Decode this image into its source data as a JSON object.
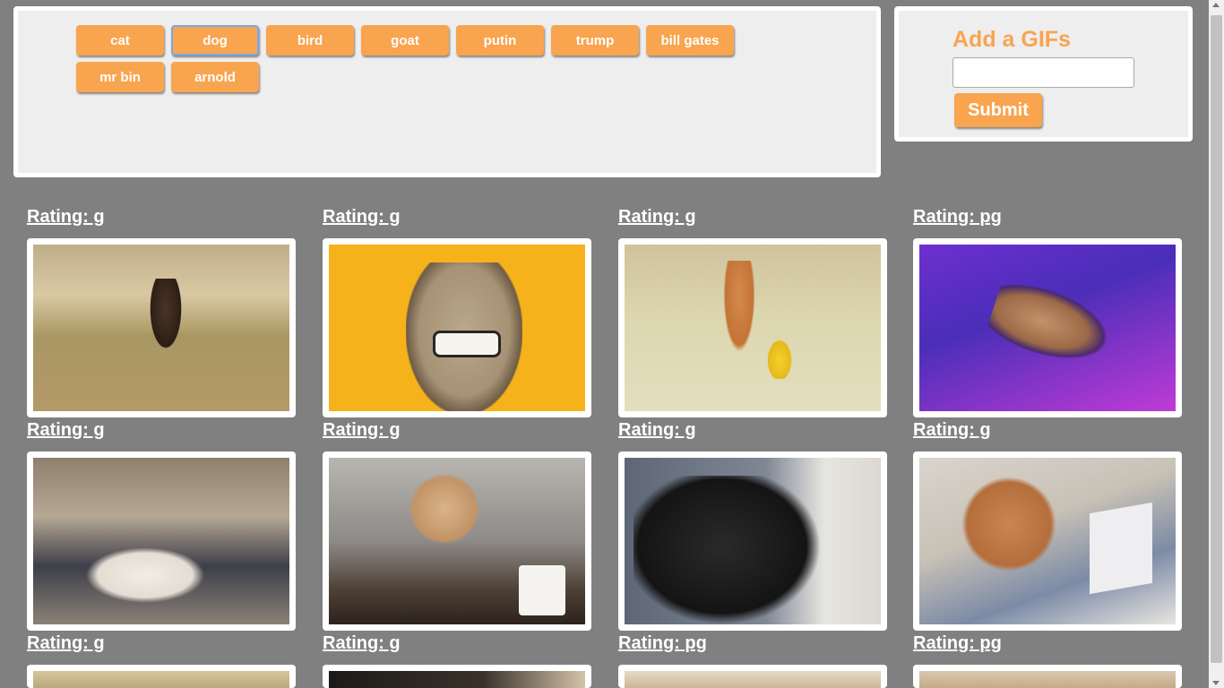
{
  "topics": [
    "cat",
    "dog",
    "bird",
    "goat",
    "putin",
    "trump",
    "bill gates",
    "mr bin",
    "arnold"
  ],
  "active_topic": "dog",
  "add_form": {
    "title": "Add a GIFs",
    "input_value": "",
    "submit_label": "Submit"
  },
  "gifs": [
    {
      "rating": "Rating: g",
      "subject": "beagle-running-in-field"
    },
    {
      "rating": "Rating: g",
      "subject": "pug-with-teeth"
    },
    {
      "rating": "Rating: g",
      "subject": "shiba-on-sofa-with-pikachu"
    },
    {
      "rating": "Rating: pg",
      "subject": "flying-french-bulldog"
    },
    {
      "rating": "Rating: g",
      "subject": "dog-bath-in-tub"
    },
    {
      "rating": "Rating: g",
      "subject": "dog-head-eating-mcdonalds"
    },
    {
      "rating": "Rating: g",
      "subject": "black-dog-close-up"
    },
    {
      "rating": "Rating: g",
      "subject": "shiba-with-laptop"
    },
    {
      "rating": "Rating: g",
      "subject": "partial-gif"
    },
    {
      "rating": "Rating: g",
      "subject": "partial-gif"
    },
    {
      "rating": "Rating: pg",
      "subject": "partial-gif"
    },
    {
      "rating": "Rating: pg",
      "subject": "partial-gif"
    }
  ]
}
